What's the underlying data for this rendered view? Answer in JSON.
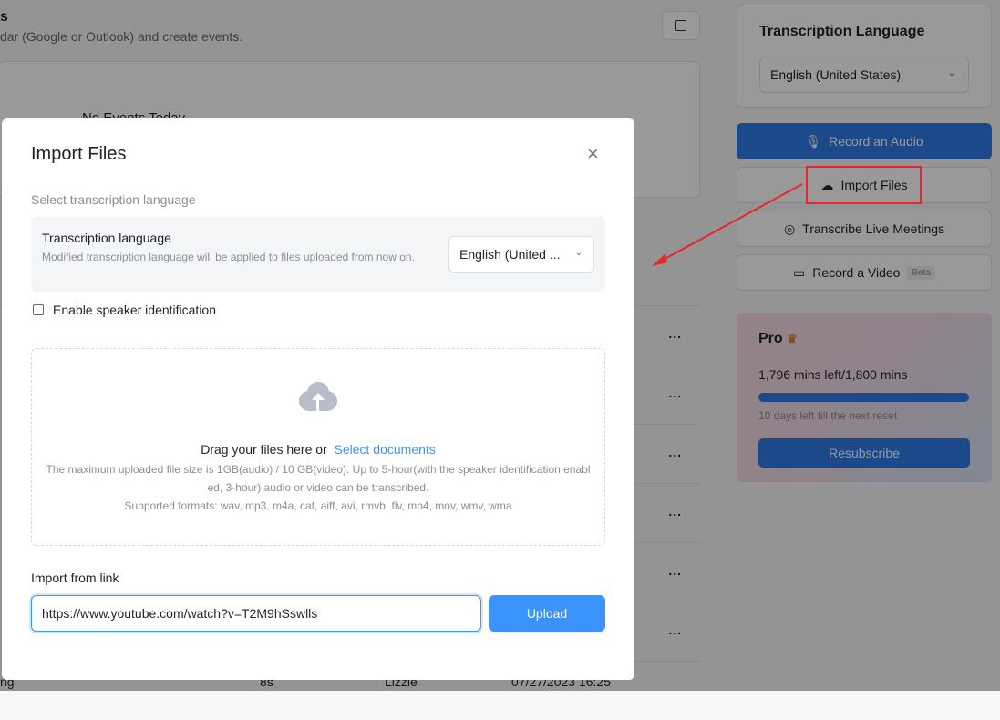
{
  "background": {
    "header_title_fragment": "s",
    "header_subtitle": "dar (Google or Outlook) and create events.",
    "no_events": "No Events Today",
    "last_row": {
      "name": "ng",
      "duration": "8s",
      "owner": "Lizzie",
      "date": "07/27/2023 16:25"
    },
    "more_label": "..."
  },
  "sidebar": {
    "lang_title": "Transcription Language",
    "lang_value": "English (United States)",
    "record_audio": "Record an Audio",
    "import_files": "Import Files",
    "live_meetings": "Transcribe Live Meetings",
    "record_video": "Record a Video",
    "beta": "Beta",
    "plan": {
      "name": "Pro",
      "usage": "1,796 mins left/1,800 mins",
      "used_fraction": 0.998,
      "reset": "10 days left till the next reset",
      "resubscribe": "Resubscribe"
    },
    "accent": "#2f7ae5"
  },
  "modal": {
    "title": "Import Files",
    "section_label": "Select transcription language",
    "lang_label": "Transcription language",
    "lang_hint": "Modified transcription language will be applied to files uploaded from now on.",
    "lang_value": "English (United ...",
    "speaker_id": "Enable speaker identification",
    "speaker_id_checked": false,
    "drop_text": "Drag your files here or",
    "select_docs": "Select documents",
    "limits": "The maximum uploaded file size is 1GB(audio) / 10 GB(video). Up to 5-hour(with the speaker identification enabled, 3-hour) audio or video can be transcribed.",
    "formats": "Supported formats: wav, mp3, m4a, caf, aiff, avi, rmvb, flv, mp4, mov, wmv, wma",
    "link_label": "Import from link",
    "link_value": "https://www.youtube.com/watch?v=T2M9hSswlls",
    "upload": "Upload",
    "accent": "#3b94fb"
  },
  "annotation_color": "#e8262b"
}
